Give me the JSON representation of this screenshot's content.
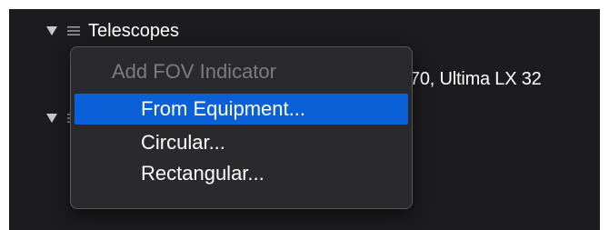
{
  "outline": {
    "telescopes_label": "Telescopes",
    "equipment_summary": "170, Ultima LX 32"
  },
  "context_menu": {
    "header": "Add FOV Indicator",
    "items": [
      {
        "label": "From Equipment...",
        "selected": true
      },
      {
        "label": "Circular...",
        "selected": false
      },
      {
        "label": "Rectangular...",
        "selected": false
      }
    ]
  },
  "colors": {
    "background": "#1c1c1e",
    "menu_background": "#2a2a2c",
    "selection": "#0a60d6",
    "disabled_text": "#7c7c80",
    "text": "#ffffff"
  },
  "icons": {
    "disclosure": "disclosure-triangle-down-icon",
    "list": "list-lines-icon"
  }
}
